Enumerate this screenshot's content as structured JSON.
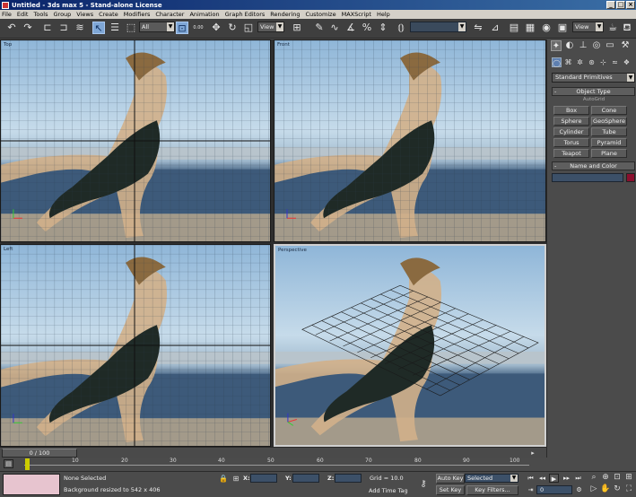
{
  "window": {
    "title": "Untitled - 3ds max 5 - Stand-alone License",
    "controls": [
      "_",
      "□",
      "×"
    ]
  },
  "menu": [
    "File",
    "Edit",
    "Tools",
    "Group",
    "Views",
    "Create",
    "Modifiers",
    "Character",
    "Animation",
    "Graph Editors",
    "Rendering",
    "Customize",
    "MAXScript",
    "Help"
  ],
  "toolbar": {
    "selection_filter": "All",
    "ref_coord": "View",
    "view_dropdown2": "View",
    "spinner_label": "0.00"
  },
  "viewports": [
    {
      "label": "Top"
    },
    {
      "label": "Front"
    },
    {
      "label": "Left"
    },
    {
      "label": "Perspective"
    }
  ],
  "command_panel": {
    "category": "Standard Primitives",
    "object_type_title": "Object Type",
    "autogrid_label": "AutoGrid",
    "primitives": [
      "Box",
      "Cone",
      "Sphere",
      "GeoSphere",
      "Cylinder",
      "Tube",
      "Torus",
      "Pyramid",
      "Teapot",
      "Plane"
    ],
    "name_color_title": "Name and Color",
    "swatch_color": "#8b0f2e"
  },
  "time_slider": {
    "position": "0 / 100",
    "current_fraction": 0.0
  },
  "track": {
    "ticks": [
      "10",
      "20",
      "30",
      "40",
      "50",
      "60",
      "70",
      "80",
      "90",
      "100"
    ]
  },
  "status": {
    "selection": "None Selected",
    "prompt": "Background resized to 542 x 406",
    "x_label": "X:",
    "y_label": "Y:",
    "z_label": "Z:",
    "grid": "Grid = 10.0",
    "add_time_tag": "Add Time Tag",
    "auto_key": "Auto Key",
    "key_mode": "Selected",
    "set_key": "Set Key",
    "key_filters": "Key Filters...",
    "frame": "0"
  }
}
